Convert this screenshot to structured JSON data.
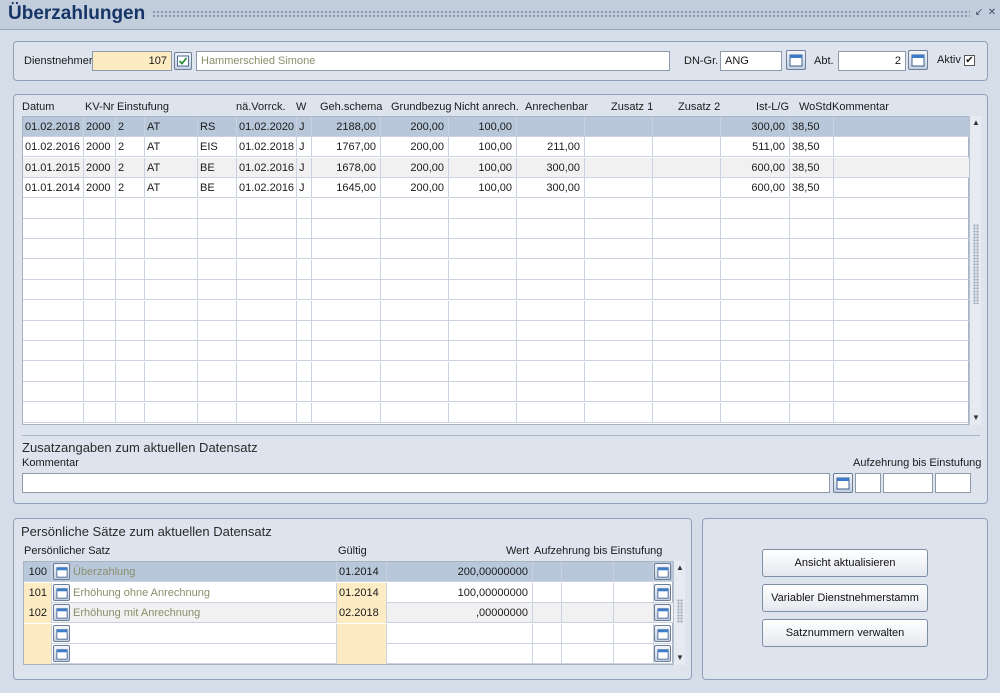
{
  "window": {
    "title": "Überzahlungen"
  },
  "employee": {
    "label": "Dienstnehmer",
    "number": "107",
    "name": "Hammerschied Simone",
    "group_label": "DN-Gr.",
    "group": "ANG",
    "dept_label": "Abt.",
    "dept": "2",
    "active_label": "Aktiv",
    "active_mark": "✔"
  },
  "table": {
    "headers": {
      "datum": "Datum",
      "kvnr": "KV-Nr",
      "einstufung": "Einstufung",
      "vorrueck": "nä.Vorrck.",
      "w": "W",
      "gehschema": "Geh.schema",
      "grundbezug": "Grundbezug",
      "nichtanrech": "Nicht anrech.",
      "anrechenbar": "Anrechenbar",
      "zusatz1": "Zusatz 1",
      "zusatz2": "Zusatz 2",
      "istlg": "Ist-L/G",
      "wostd": "WoStd",
      "kommentar": "Kommentar"
    },
    "rows": [
      {
        "datum": "01.02.2018",
        "kvnr": "2000",
        "e1": "2",
        "e2": "AT",
        "e3": "RS",
        "vorrueck": "01.02.2020",
        "w": "J",
        "gehschema": "2188,00",
        "grundbezug": "200,00",
        "nichtanrech": "100,00",
        "anrechenbar": "",
        "zusatz1": "",
        "zusatz2": "",
        "istlg": "300,00",
        "wostd": "38,50",
        "kommentar": ""
      },
      {
        "datum": "01.02.2016",
        "kvnr": "2000",
        "e1": "2",
        "e2": "AT",
        "e3": "EIS",
        "vorrueck": "01.02.2018",
        "w": "J",
        "gehschema": "1767,00",
        "grundbezug": "200,00",
        "nichtanrech": "100,00",
        "anrechenbar": "211,00",
        "zusatz1": "",
        "zusatz2": "",
        "istlg": "511,00",
        "wostd": "38,50",
        "kommentar": ""
      },
      {
        "datum": "01.01.2015",
        "kvnr": "2000",
        "e1": "2",
        "e2": "AT",
        "e3": "BE",
        "vorrueck": "01.02.2016",
        "w": "J",
        "gehschema": "1678,00",
        "grundbezug": "200,00",
        "nichtanrech": "100,00",
        "anrechenbar": "300,00",
        "zusatz1": "",
        "zusatz2": "",
        "istlg": "600,00",
        "wostd": "38,50",
        "kommentar": ""
      },
      {
        "datum": "01.01.2014",
        "kvnr": "2000",
        "e1": "2",
        "e2": "AT",
        "e3": "BE",
        "vorrueck": "01.02.2016",
        "w": "J",
        "gehschema": "1645,00",
        "grundbezug": "200,00",
        "nichtanrech": "100,00",
        "anrechenbar": "300,00",
        "zusatz1": "",
        "zusatz2": "",
        "istlg": "600,00",
        "wostd": "38,50",
        "kommentar": ""
      }
    ]
  },
  "extra": {
    "title": "Zusatzangaben zum aktuellen Datensatz",
    "comment_label": "Kommentar",
    "comment": "",
    "consume_label": "Aufzehrung bis Einstufung"
  },
  "personal": {
    "title": "Persönliche Sätze zum aktuellen Datensatz",
    "headers": {
      "satz": "Persönlicher Satz",
      "gueltig": "Gültig",
      "wert": "Wert",
      "aufzehrung": "Aufzehrung bis Einstufung"
    },
    "rows": [
      {
        "nr": "100",
        "name": "Überzahlung",
        "gueltig": "01.2014",
        "wert": "200,00000000"
      },
      {
        "nr": "101",
        "name": "Erhöhung ohne Anrechnung",
        "gueltig": "01.2014",
        "wert": "100,00000000"
      },
      {
        "nr": "102",
        "name": "Erhöhung mit Anrechnung",
        "gueltig": "02.2018",
        "wert": ",00000000"
      }
    ]
  },
  "actions": {
    "refresh": "Ansicht aktualisieren",
    "variable_master": "Variabler Dienstnehmerstamm",
    "manage_numbers": "Satznummern verwalten"
  }
}
